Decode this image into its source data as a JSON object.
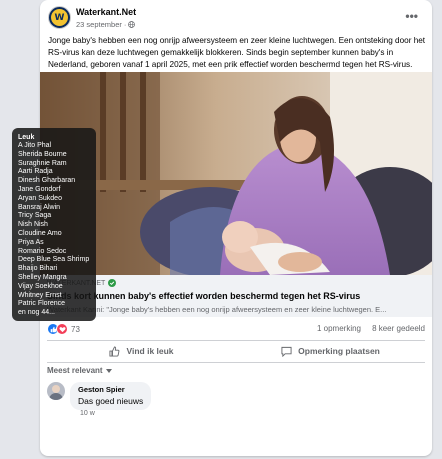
{
  "post": {
    "page_name": "Waterkant.Net",
    "date": "23 september",
    "date_separator": "·",
    "more": "•••",
    "text": "Jonge baby's hebben een nog onrijp afweersysteem en zeer kleine luchtwegen. Een ontsteking door het RS-virus kan deze luchtwegen gemakkelijk blokkeren. Sinds begin september kunnen baby's in Nederland, geboren vanaf 1 april 2025, met een prik effectief worden beschermd tegen het RS-virus."
  },
  "link": {
    "domain": "WATERKANT.NET",
    "title": "Sinds kort kunnen baby's effectief worden beschermd tegen het RS-virus",
    "description": "Waterkant Kanni: \"Jonge baby's hebben een nog onrijp afweersysteem en zeer kleine luchtwegen. E..."
  },
  "stats": {
    "reaction_count": "73",
    "comments": "1 opmerking",
    "shares": "8 keer gedeeld"
  },
  "actions": {
    "like": "Vind ik leuk",
    "comment": "Opmerking plaatsen"
  },
  "comments_section": {
    "sort_label": "Meest relevant",
    "items": [
      {
        "name": "Geston Spier",
        "text": "Das goed nieuws",
        "time": "10 w"
      }
    ]
  },
  "tooltip": {
    "title": "Leuk",
    "names": [
      "A Jito Phal",
      "Sherida Bourne",
      "Suraghnie Ram",
      "Aarti Radja",
      "Dinesh Gharbaran",
      "Jane Gondorf",
      "Aryan Sukdeo",
      "Bansraj Alwin",
      "Tricy Saga",
      "Nish Nish",
      "Cloudine Amo",
      "Priya As",
      "Romario Sedoc",
      "Deep Blue Sea Shrimp",
      "Bhaijo Bihari",
      "Shelley Mangra",
      "Vijay Soekhoe",
      "Whitney Ernst",
      "Patric Florence",
      "en nog 44..."
    ]
  },
  "colors": {
    "brand_blue": "#1877f2",
    "love_red": "#f33e58",
    "verified_green": "#2e9b47",
    "avatar_navy": "#0a2a5c",
    "avatar_yellow": "#f2c230"
  },
  "icons": [
    "globe-icon",
    "more-icon",
    "verified-icon",
    "like-icon",
    "love-icon",
    "thumbs-up-icon",
    "comment-icon",
    "caret-down-icon"
  ]
}
